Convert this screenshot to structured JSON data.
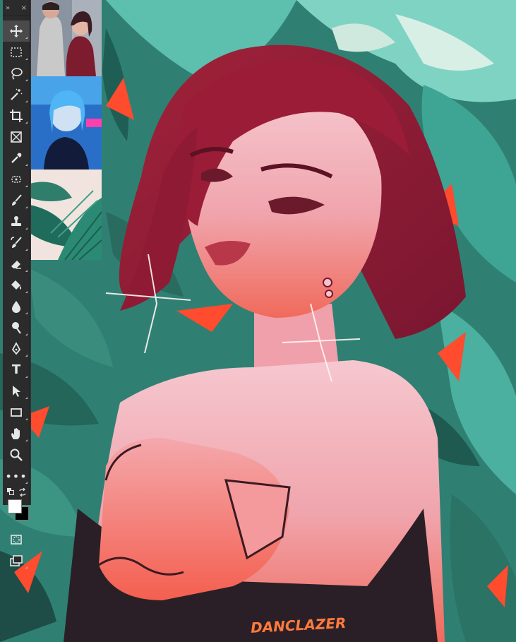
{
  "app": {
    "toolbar": {
      "collapse_glyph": "»",
      "close_glyph": "×",
      "more_glyph": "•••",
      "type_tool_glyph": "T"
    },
    "colors": {
      "foreground": "#ffffff",
      "background": "#000000",
      "toolbar_bg": "#2b2b2b",
      "icon": "#e6e6e6"
    }
  },
  "tools": [
    {
      "id": "move",
      "icon": "move-icon",
      "active": true
    },
    {
      "id": "marquee",
      "icon": "rect-marquee-icon"
    },
    {
      "id": "lasso",
      "icon": "lasso-icon"
    },
    {
      "id": "magic-wand",
      "icon": "magic-wand-icon"
    },
    {
      "id": "crop",
      "icon": "crop-icon"
    },
    {
      "id": "frame",
      "icon": "frame-icon"
    },
    {
      "id": "eyedropper",
      "icon": "eyedropper-icon"
    },
    {
      "id": "healing",
      "icon": "healing-brush-icon"
    },
    {
      "id": "brush",
      "icon": "brush-icon"
    },
    {
      "id": "stamp",
      "icon": "clone-stamp-icon"
    },
    {
      "id": "history-brush",
      "icon": "history-brush-icon"
    },
    {
      "id": "eraser",
      "icon": "eraser-icon"
    },
    {
      "id": "paint-bucket",
      "icon": "paint-bucket-icon"
    },
    {
      "id": "blur",
      "icon": "blur-drop-icon"
    },
    {
      "id": "dodge",
      "icon": "dodge-icon"
    },
    {
      "id": "pen",
      "icon": "pen-icon"
    },
    {
      "id": "type",
      "icon": "type-icon"
    },
    {
      "id": "path-select",
      "icon": "path-selection-icon"
    },
    {
      "id": "shape",
      "icon": "rectangle-shape-icon"
    },
    {
      "id": "hand",
      "icon": "hand-icon"
    },
    {
      "id": "zoom",
      "icon": "zoom-icon"
    }
  ],
  "artwork": {
    "signature": "DANCLAZER",
    "reference_images": [
      "reference-couple-image",
      "reference-blue-hair-image",
      "reference-leaves-image"
    ]
  }
}
